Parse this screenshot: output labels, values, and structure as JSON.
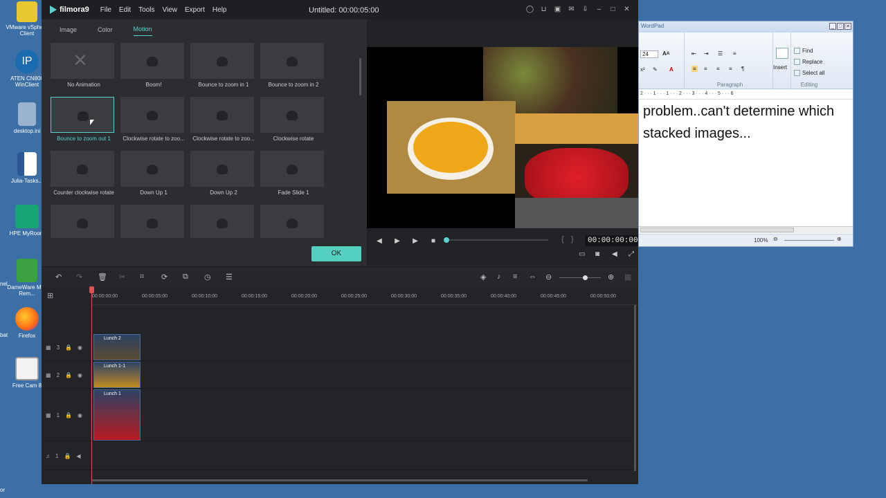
{
  "desktop": {
    "icons": [
      {
        "label": "VMware vSphere Client"
      },
      {
        "label": "ATEN CN800 WinClient"
      },
      {
        "label": "desktop.ini"
      },
      {
        "label": "Julia-Tasks..."
      },
      {
        "label": "HPE MyRoom"
      },
      {
        "label": "DameWare Mini Rem..."
      },
      {
        "label": "Firefox"
      },
      {
        "label": "Free Cam 8"
      }
    ],
    "cut_labels": [
      "nel",
      "bat",
      "or"
    ]
  },
  "filmora": {
    "logo": "filmora9",
    "menu": [
      "File",
      "Edit",
      "Tools",
      "View",
      "Export",
      "Help"
    ],
    "window_title": "Untitled:  00:00:05:00",
    "tabs": [
      "Image",
      "Color",
      "Motion"
    ],
    "active_tab": "Motion",
    "animations": [
      "No Animation",
      "Boom!",
      "Bounce to zoom in 1",
      "Bounce to zoom in 2",
      "Bounce to zoom out 1",
      "Clockwise rotate to zoo...",
      "Clockwise rotate to zoo...",
      "Clockwise rotate",
      "Counter clockwise rotate",
      "Down Up 1",
      "Down Up 2",
      "Fade Slide 1",
      "",
      "",
      "",
      ""
    ],
    "selected_animation": "Bounce to zoom out 1",
    "ok_label": "OK",
    "timecode": "00:00:00:00",
    "ruler_ticks": [
      "00:00:00:00",
      "00:00:05:00",
      "00:00:10:00",
      "00:00:15:00",
      "00:00:20:00",
      "00:00:25:00",
      "00:00:30:00",
      "00:00:35:00",
      "00:00:40:00",
      "00:00:45:00",
      "00:00:50:00"
    ],
    "tracks": [
      {
        "num": "3",
        "clip": "Lunch 2"
      },
      {
        "num": "2",
        "clip": "Lunch 1-1"
      },
      {
        "num": "1",
        "clip": "Lunch 1"
      },
      {
        "num": "1",
        "clip": ""
      }
    ],
    "colors": {
      "accent": "#5ad1d0",
      "ok": "#55cfc0",
      "playhead": "#e05050"
    }
  },
  "wordpad": {
    "title": "WordPad",
    "font_size": "24",
    "groups": [
      "Paragraph",
      "Editing"
    ],
    "insert_label": "Insert",
    "editing_items": [
      "Find",
      "Replace",
      "Select all"
    ],
    "document_lines": [
      "problem..can't determine which",
      "stacked images..."
    ],
    "zoom": "100%"
  }
}
